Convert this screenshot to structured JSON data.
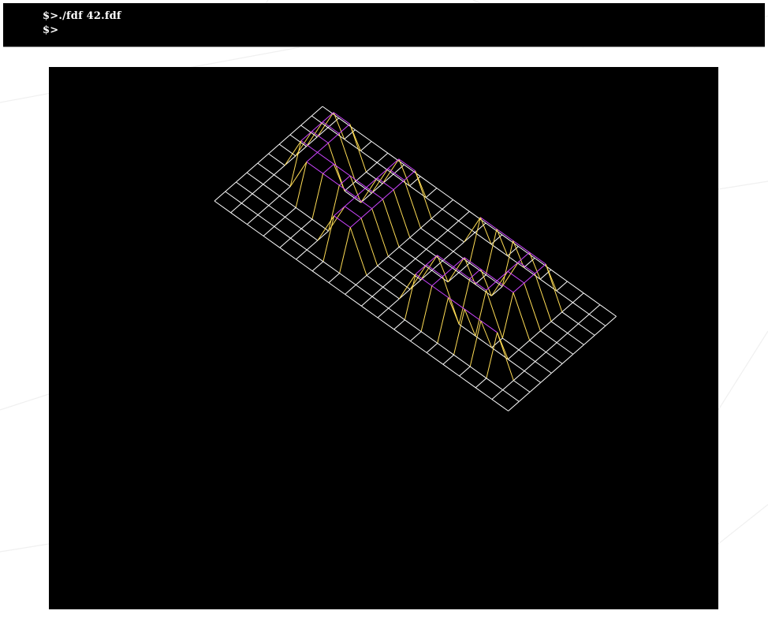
{
  "terminal": {
    "lines": [
      "$>./fdf 42.fdf",
      "$>"
    ]
  },
  "fdf_window": {
    "background": "#000000",
    "colors": {
      "base": "#ffffff",
      "low": "#ffdd55",
      "high": "#cc44ff"
    },
    "map": [
      [
        0,
        0,
        0,
        0,
        0,
        0,
        0,
        0,
        0,
        0,
        0,
        0,
        0,
        0,
        0,
        0,
        0,
        0,
        0
      ],
      [
        0,
        0,
        0,
        0,
        0,
        0,
        0,
        0,
        0,
        0,
        0,
        0,
        0,
        0,
        0,
        0,
        0,
        0,
        0
      ],
      [
        0,
        0,
        10,
        10,
        0,
        0,
        10,
        10,
        0,
        0,
        0,
        10,
        10,
        10,
        10,
        10,
        0,
        0,
        0
      ],
      [
        0,
        0,
        10,
        10,
        0,
        0,
        10,
        10,
        0,
        0,
        0,
        0,
        0,
        0,
        10,
        10,
        0,
        0,
        0
      ],
      [
        0,
        0,
        10,
        10,
        0,
        0,
        10,
        10,
        0,
        0,
        0,
        0,
        0,
        0,
        10,
        10,
        0,
        0,
        0
      ],
      [
        0,
        0,
        10,
        10,
        10,
        10,
        10,
        10,
        0,
        0,
        0,
        0,
        10,
        10,
        10,
        10,
        0,
        0,
        0
      ],
      [
        0,
        0,
        0,
        10,
        10,
        10,
        10,
        10,
        0,
        0,
        0,
        10,
        10,
        10,
        10,
        0,
        0,
        0,
        0
      ],
      [
        0,
        0,
        0,
        0,
        0,
        0,
        10,
        10,
        0,
        0,
        0,
        10,
        10,
        0,
        0,
        0,
        0,
        0,
        0
      ],
      [
        0,
        0,
        0,
        0,
        0,
        0,
        10,
        10,
        0,
        0,
        0,
        10,
        10,
        10,
        10,
        10,
        10,
        0,
        0
      ],
      [
        0,
        0,
        0,
        0,
        0,
        0,
        0,
        0,
        0,
        0,
        0,
        0,
        0,
        0,
        0,
        0,
        0,
        0,
        0
      ],
      [
        0,
        0,
        0,
        0,
        0,
        0,
        0,
        0,
        0,
        0,
        0,
        0,
        0,
        0,
        0,
        0,
        0,
        0,
        0
      ]
    ]
  }
}
